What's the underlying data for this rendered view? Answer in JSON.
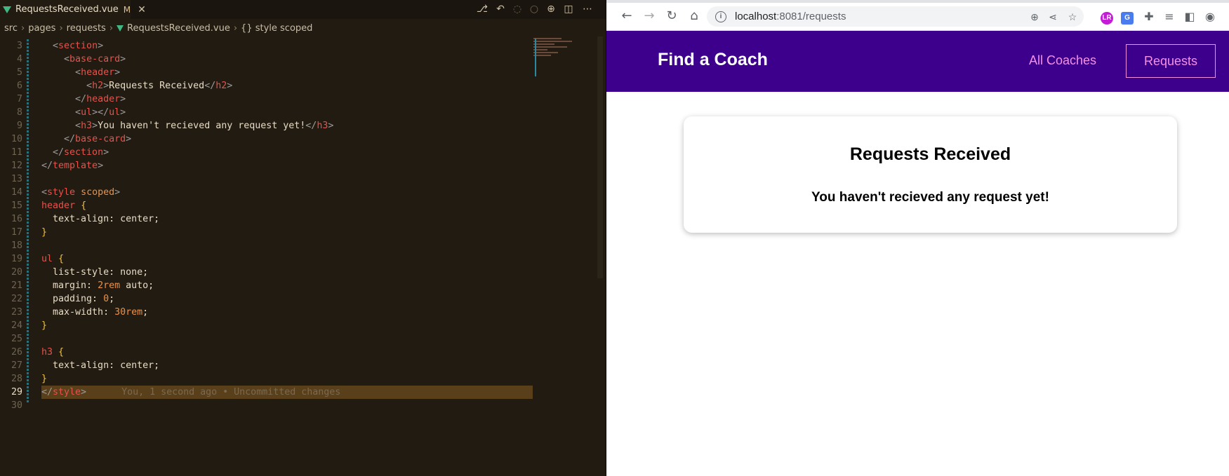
{
  "editor": {
    "tab": {
      "filename": "RequestsReceived.vue",
      "modified": "M",
      "close": "✕"
    },
    "breadcrumb": [
      "src",
      "pages",
      "requests",
      "RequestsReceived.vue",
      "{} style scoped"
    ],
    "blame": "You, 1 second ago • Uncommitted changes",
    "lines": [
      {
        "n": "3"
      },
      {
        "n": "4"
      },
      {
        "n": "5"
      },
      {
        "n": "6"
      },
      {
        "n": "7"
      },
      {
        "n": "8"
      },
      {
        "n": "9"
      },
      {
        "n": "10"
      },
      {
        "n": "11"
      },
      {
        "n": "12"
      },
      {
        "n": "13"
      },
      {
        "n": "14"
      },
      {
        "n": "15"
      },
      {
        "n": "16"
      },
      {
        "n": "17"
      },
      {
        "n": "18"
      },
      {
        "n": "19"
      },
      {
        "n": "20"
      },
      {
        "n": "21"
      },
      {
        "n": "22"
      },
      {
        "n": "23"
      },
      {
        "n": "24"
      },
      {
        "n": "25"
      },
      {
        "n": "26"
      },
      {
        "n": "27"
      },
      {
        "n": "28"
      },
      {
        "n": "29"
      },
      {
        "n": "30"
      }
    ],
    "code": {
      "l3": "section",
      "l4": "base-card",
      "l5": "header",
      "l6_a": "h2",
      "l6_t": "Requests Received",
      "l7": "header",
      "l8": "ul",
      "l9": "h3",
      "l9_t": "You haven't recieved any request yet!",
      "l10": "base-card",
      "l11": "section",
      "l12": "template",
      "l14_tag": "style",
      "l14_attr": "scoped",
      "sel_header": "header",
      "decl_text_align": "text-align: center;",
      "sel_ul": "ul",
      "decl_list_style": "list-style: none;",
      "decl_margin_k": "margin: ",
      "decl_margin_n": "2rem",
      "decl_margin_v": " auto;",
      "decl_padding_k": "padding: ",
      "decl_padding_n": "0",
      "decl_maxw_k": "max-width: ",
      "decl_maxw_n": "30rem",
      "sel_h3": "h3",
      "style_close": "style"
    }
  },
  "browser": {
    "url_host": "localhost",
    "url_path": ":8081/requests",
    "extensions": [
      "LR",
      "G"
    ],
    "nav": {
      "brand": "Find a Coach",
      "all_coaches": "All Coaches",
      "requests": "Requests"
    },
    "card": {
      "title": "Requests Received",
      "empty_message": "You haven't recieved any request yet!"
    }
  }
}
